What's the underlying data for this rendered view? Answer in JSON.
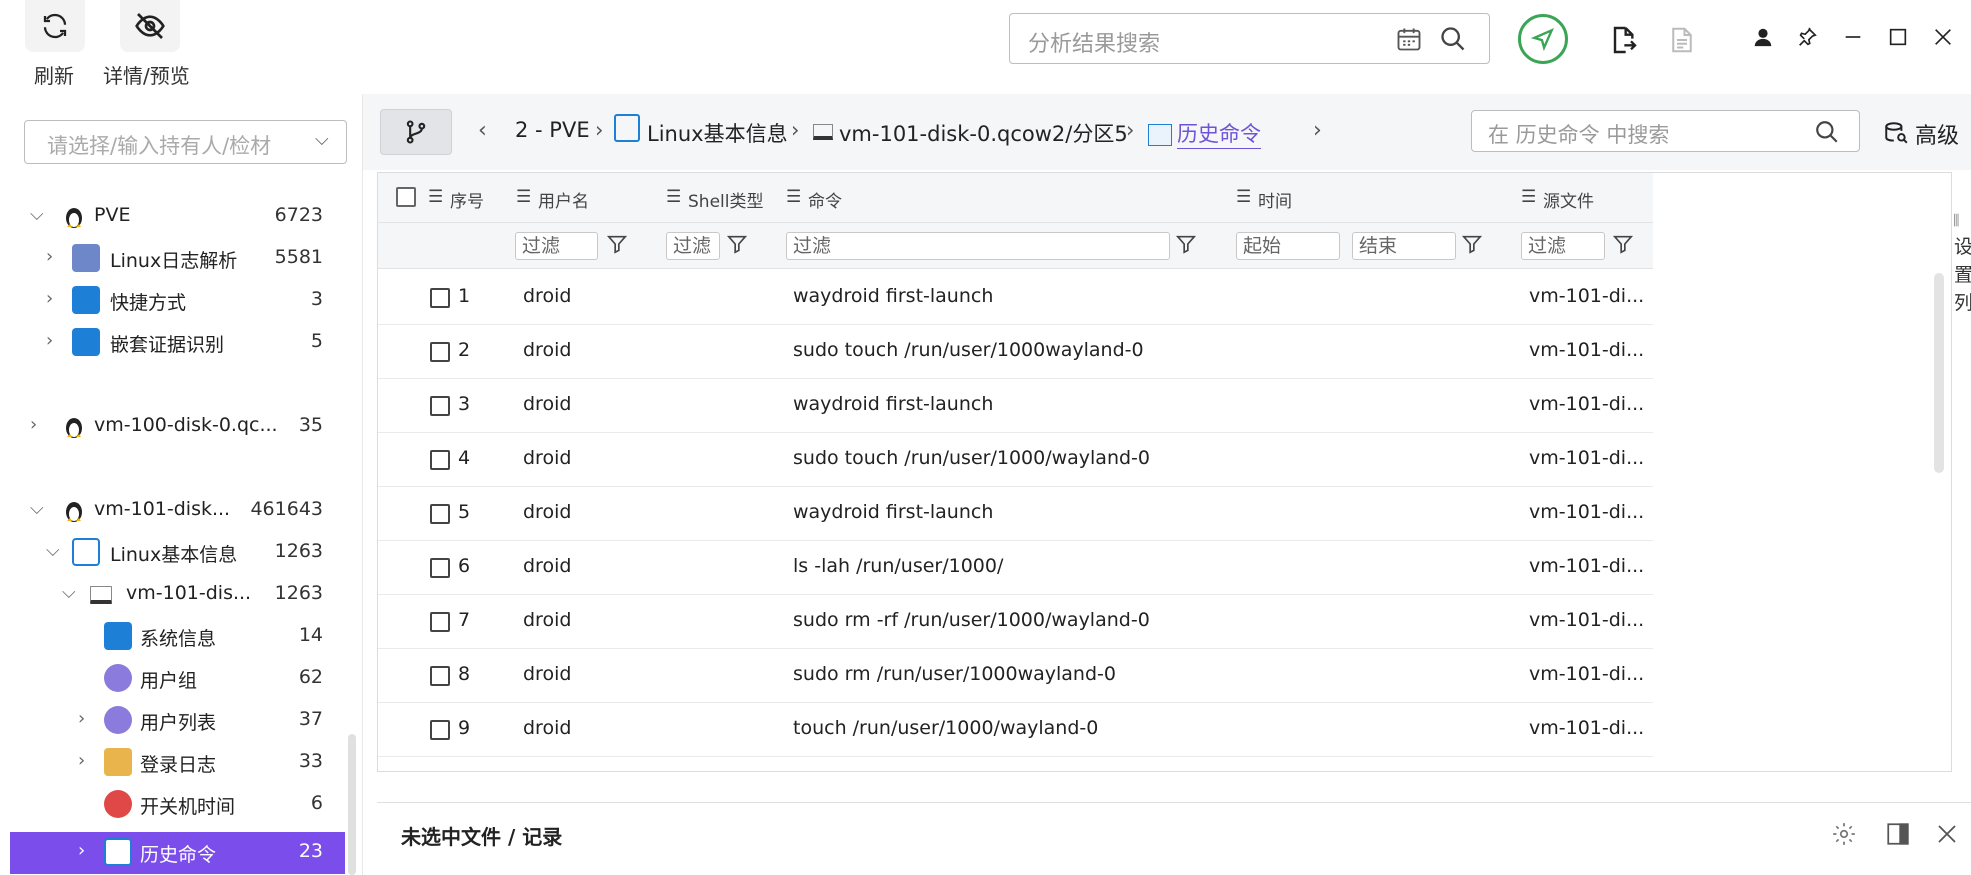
{
  "toolbar": {
    "refresh_label": "刷新",
    "details_label": "详情/预览",
    "search_placeholder": "分析结果搜索"
  },
  "left_panel": {
    "owner_placeholder": "请选择/输入持有人/检材",
    "tree": [
      {
        "label": "PVE",
        "count": "6723"
      },
      {
        "label": "Linux日志解析",
        "count": "5581"
      },
      {
        "label": "快捷方式",
        "count": "3"
      },
      {
        "label": "嵌套证据识别",
        "count": "5"
      },
      {
        "label": "vm-100-disk-0.qc...",
        "count": "35"
      },
      {
        "label": "vm-101-disk...",
        "count": "461643"
      },
      {
        "label": "Linux基本信息",
        "count": "1263"
      },
      {
        "label": "vm-101-dis...",
        "count": "1263"
      },
      {
        "label": "系统信息",
        "count": "14"
      },
      {
        "label": "用户组",
        "count": "62"
      },
      {
        "label": "用户列表",
        "count": "37"
      },
      {
        "label": "登录日志",
        "count": "33"
      },
      {
        "label": "开关机时间",
        "count": "6"
      },
      {
        "label": "历史命令",
        "count": "23"
      }
    ]
  },
  "breadcrumb": {
    "items": [
      "2 - PVE",
      "Linux基本信息",
      "vm-101-disk-0.qcow2/分区5",
      "历史命令"
    ],
    "search_placeholder": "在 历史命令 中搜索",
    "advanced_label": "高级"
  },
  "table": {
    "headers": [
      "序号",
      "用户名",
      "Shell类型",
      "命令",
      "时间",
      "源文件"
    ],
    "filters": {
      "filter": "过滤",
      "start": "起始",
      "end": "结束"
    },
    "rows": [
      {
        "id": "1",
        "user": "droid",
        "cmd": "waydroid first-launch",
        "src": "vm-101-di..."
      },
      {
        "id": "2",
        "user": "droid",
        "cmd": "sudo touch /run/user/1000wayland-0",
        "src": "vm-101-di..."
      },
      {
        "id": "3",
        "user": "droid",
        "cmd": "waydroid first-launch",
        "src": "vm-101-di..."
      },
      {
        "id": "4",
        "user": "droid",
        "cmd": "sudo touch /run/user/1000/wayland-0",
        "src": "vm-101-di..."
      },
      {
        "id": "5",
        "user": "droid",
        "cmd": "waydroid first-launch",
        "src": "vm-101-di..."
      },
      {
        "id": "6",
        "user": "droid",
        "cmd": "ls -lah /run/user/1000/",
        "src": "vm-101-di..."
      },
      {
        "id": "7",
        "user": "droid",
        "cmd": "sudo rm -rf /run/user/1000/wayland-0",
        "src": "vm-101-di..."
      },
      {
        "id": "8",
        "user": "droid",
        "cmd": "sudo rm /run/user/1000wayland-0",
        "src": "vm-101-di..."
      },
      {
        "id": "9",
        "user": "droid",
        "cmd": "touch /run/user/1000/wayland-0",
        "src": "vm-101-di..."
      }
    ],
    "side_settings": "设置列"
  },
  "bottom_panel": {
    "title": "未选中文件 / 记录"
  },
  "colors": {
    "accent": "#7b4dea",
    "green": "#3aa655"
  }
}
